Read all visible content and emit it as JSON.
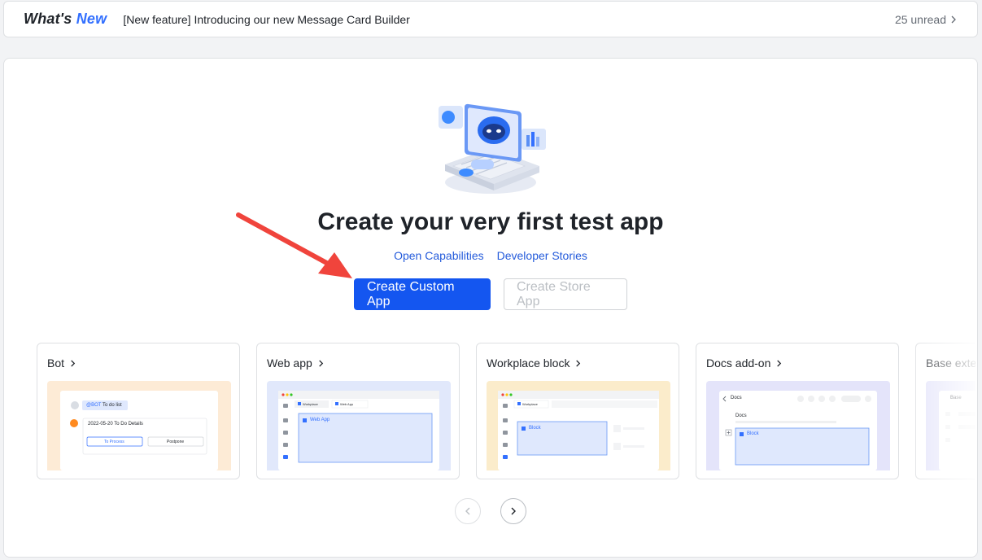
{
  "topbar": {
    "brand_part1": "What's",
    "brand_part2": "New",
    "announcement": "[New feature] Introducing our new Message Card Builder",
    "unread": "25 unread"
  },
  "hero": {
    "title": "Create your very first test app",
    "link_capabilities": "Open Capabilities",
    "link_stories": "Developer Stories",
    "btn_custom": "Create Custom App",
    "btn_store": "Create Store App"
  },
  "cards": [
    {
      "title": "Bot",
      "bot_mention": "@BOT",
      "bot_msg": "To do list",
      "todo_details": "2022-05-20 To Do Details",
      "btn_process": "To Process",
      "btn_postpone": "Postpone"
    },
    {
      "title": "Web app",
      "tab1": "Workplace",
      "tab2": "Web App",
      "box_label": "Web App"
    },
    {
      "title": "Workplace block",
      "tab1": "Workplace",
      "box_label": "Block"
    },
    {
      "title": "Docs add-on",
      "crumb": "Docs",
      "heading": "Docs",
      "box_label": "Block"
    },
    {
      "title": "Base exte",
      "crumb": "Base"
    }
  ],
  "colors": {
    "primary": "#1456f0",
    "link": "#245bdb",
    "brand_blue": "#3370ff",
    "bot_bg": "#fdebd6",
    "web_bg": "#e1e8fb",
    "block_bg": "#fbeccb",
    "docs_bg": "#e4e4fa"
  }
}
